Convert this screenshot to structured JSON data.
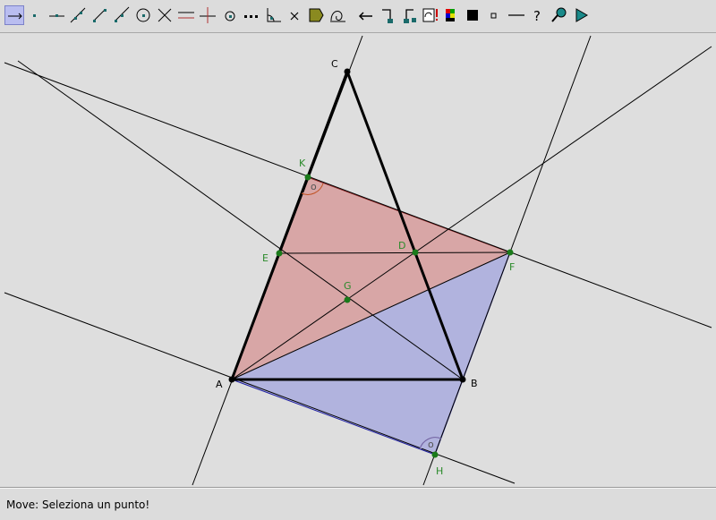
{
  "toolbar": {
    "tools": [
      {
        "icon": "move-arrow-icon"
      },
      {
        "icon": "point-icon"
      },
      {
        "icon": "point-on-line-icon"
      },
      {
        "icon": "line-icon"
      },
      {
        "icon": "segment-icon"
      },
      {
        "icon": "ray-icon"
      },
      {
        "icon": "circle-icon"
      },
      {
        "icon": "intersection-icon"
      },
      {
        "icon": "parallel-line-icon"
      },
      {
        "icon": "perpendicular-line-icon"
      },
      {
        "icon": "midpoint-icon"
      },
      {
        "icon": "dotted-line-icon"
      },
      {
        "icon": "angle-icon"
      },
      {
        "icon": "delete-x-icon"
      },
      {
        "icon": "polygon-fill-icon"
      },
      {
        "icon": "locus-icon"
      },
      {
        "icon": "undo-arrow-icon"
      },
      {
        "icon": "step-forward-icon"
      },
      {
        "icon": "step-back-icon"
      },
      {
        "icon": "macro-icon"
      },
      {
        "icon": "color-palette-icon"
      },
      {
        "icon": "fill-square-icon"
      },
      {
        "icon": "point-style-icon"
      },
      {
        "icon": "line-style-icon"
      },
      {
        "icon": "help-icon"
      },
      {
        "icon": "magnifier-icon"
      },
      {
        "icon": "play-icon"
      }
    ]
  },
  "colors": {
    "red_fill": "#d8a6a6",
    "blue_fill": "#b1b3de",
    "green_point": "#1a7a1a",
    "label_green": "#2a8a2a",
    "thick_line": "#000000"
  },
  "points": {
    "A": {
      "label": "A"
    },
    "B": {
      "label": "B"
    },
    "C": {
      "label": "C"
    },
    "D": {
      "label": "D"
    },
    "E": {
      "label": "E"
    },
    "F": {
      "label": "F"
    },
    "G": {
      "label": "G"
    },
    "H": {
      "label": "H"
    },
    "K": {
      "label": "K"
    }
  },
  "status": {
    "text": "Move: Seleziona un punto!"
  }
}
